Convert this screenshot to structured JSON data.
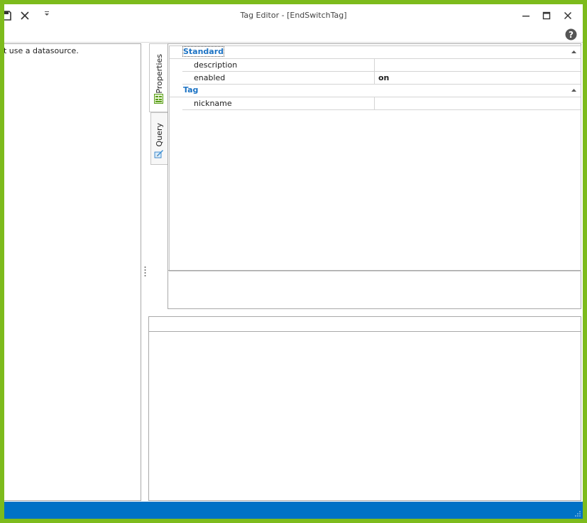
{
  "window": {
    "title": "Tag Editor - [EndSwitchTag]"
  },
  "toolbar": {
    "save_icon": "save-icon",
    "cancel_icon": "close-icon",
    "customize_icon": "chevron-down-icon"
  },
  "left_panel": {
    "message": "t use a datasource."
  },
  "tabs": [
    {
      "label": "Properties",
      "icon": "grid-icon",
      "active": true
    },
    {
      "label": "Query",
      "icon": "pencil-icon",
      "active": false
    }
  ],
  "property_grid": {
    "categories": [
      {
        "label": "Standard",
        "rows": [
          {
            "name": "description",
            "value": ""
          },
          {
            "name": "enabled",
            "value": "on"
          }
        ]
      },
      {
        "label": "Tag",
        "rows": [
          {
            "name": "nickname",
            "value": ""
          }
        ]
      }
    ]
  },
  "colors": {
    "accent": "#0072c6",
    "frame": "#7dbb1c",
    "category_text": "#1c73c4"
  }
}
